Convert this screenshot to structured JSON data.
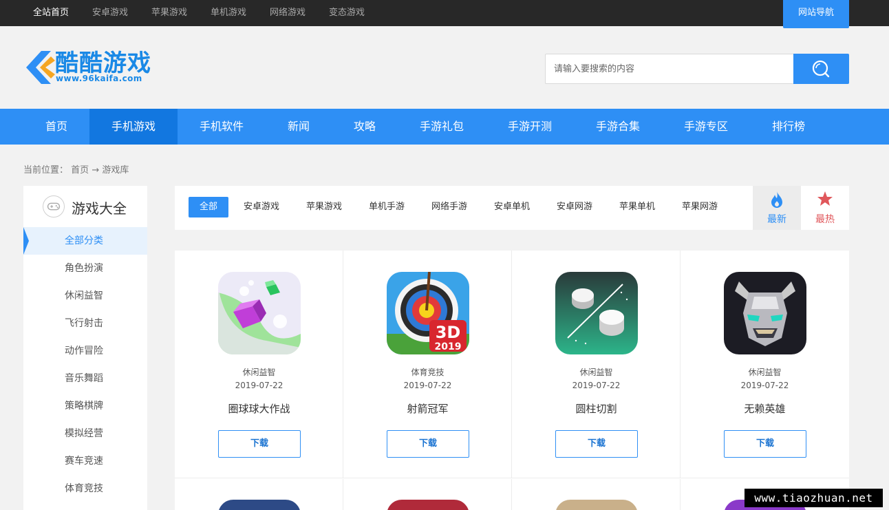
{
  "topbar": {
    "links": [
      "全站首页",
      "安卓游戏",
      "苹果游戏",
      "单机游戏",
      "网络游戏",
      "变态游戏"
    ],
    "site_nav": "网站导航"
  },
  "logo": {
    "text": "酷酷游戏",
    "url": "www.96kaifa.com"
  },
  "search": {
    "placeholder": "请输入要搜索的内容"
  },
  "mainnav": [
    "首页",
    "手机游戏",
    "手机软件",
    "新闻",
    "攻略",
    "手游礼包",
    "手游开测",
    "手游合集",
    "手游专区",
    "排行榜"
  ],
  "breadcrumb": {
    "label": "当前位置：",
    "home": "首页",
    "arrow": "→",
    "current": "游戏库"
  },
  "sidebar": {
    "title": "游戏大全",
    "items": [
      "全部分类",
      "角色扮演",
      "休闲益智",
      "飞行射击",
      "动作冒险",
      "音乐舞蹈",
      "策略棋牌",
      "模拟经营",
      "赛车竞速",
      "体育竞技"
    ]
  },
  "filters": [
    "全部",
    "安卓游戏",
    "苹果游戏",
    "单机手游",
    "网络手游",
    "安卓单机",
    "安卓网游",
    "苹果单机",
    "苹果网游"
  ],
  "sort": {
    "newest": "最新",
    "hottest": "最热"
  },
  "games": [
    {
      "category": "休闲益智",
      "date": "2019-07-22",
      "name": "圈球球大作战",
      "download": "下载",
      "icon": "cube-balls-icon"
    },
    {
      "category": "体育竞技",
      "date": "2019-07-22",
      "name": "射箭冠军",
      "download": "下载",
      "icon": "archery-target-icon",
      "badge": "3D",
      "badge_year": "2019"
    },
    {
      "category": "休闲益智",
      "date": "2019-07-22",
      "name": "圆柱切割",
      "download": "下载",
      "icon": "cylinder-slice-icon"
    },
    {
      "category": "休闲益智",
      "date": "2019-07-22",
      "name": "无赖英雄",
      "download": "下载",
      "icon": "robot-hero-icon"
    }
  ],
  "watermark": "www.tiaozhuan.net",
  "colors": {
    "accent": "#2e8ff5",
    "topbar": "#282828",
    "hot": "#e0575b"
  }
}
